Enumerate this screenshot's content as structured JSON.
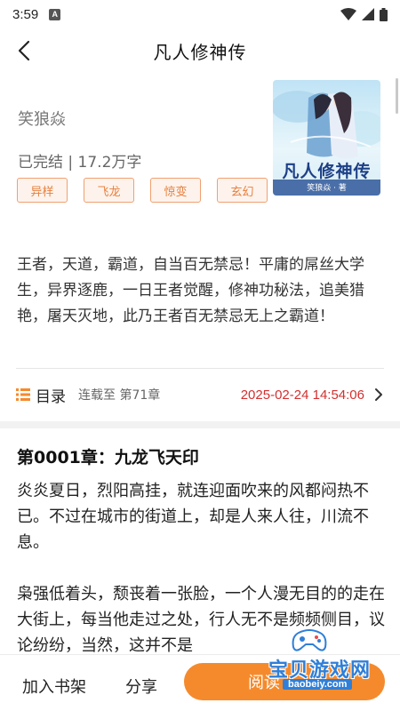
{
  "status_bar": {
    "time": "3:59",
    "notification_letter": "A"
  },
  "header": {
    "title": "凡人修神传"
  },
  "book": {
    "author": "笑狼焱",
    "stats": "已完结 | 17.2万字",
    "tags": [
      "异样",
      "飞龙",
      "惊变",
      "玄幻"
    ],
    "cover": {
      "title": "凡人修神传",
      "author_line": "笑狼焱 · 著"
    },
    "intro": "王者，天道，霸道，自当百无禁忌！平庸的屌丝大学生，异界逐鹿，一日王者觉醒，修神功秘法，追美猎艳，屠天灭地，此乃王者百无禁忌无上之霸道！"
  },
  "toc": {
    "label": "目录",
    "latest": "连载至 第71章",
    "updated": "2025-02-24 14:54:06"
  },
  "chapter": {
    "title": "第0001章：九龙飞天印",
    "paragraphs": [
      "炎炎夏日，烈阳高挂，就连迎面吹来的风都闷热不已。不过在城市的街道上，却是人来人往，川流不息。",
      "枭强低着头，颓丧着一张脸，一个人漫无目的的走在大街上，每当他走过之处，行人无不是频频侧目，议论纷纷，当然，这并不是"
    ]
  },
  "bottom_bar": {
    "add_shelf": "加入书架",
    "share": "分享",
    "read": "阅读"
  },
  "watermark": {
    "text": "宝贝游戏网",
    "url": "baobeiy.com"
  },
  "colors": {
    "accent": "#f58a2c",
    "tag_text": "#e8803e",
    "time_red": "#d32f2f"
  }
}
